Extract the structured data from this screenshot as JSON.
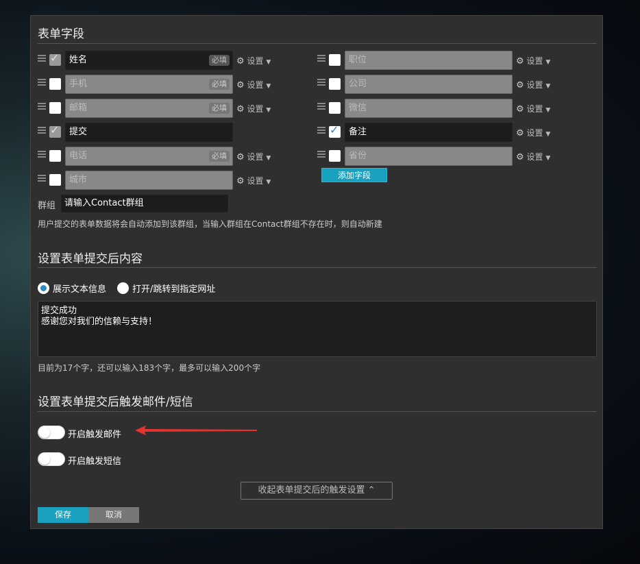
{
  "form_fields": {
    "title": "表单字段",
    "left": [
      {
        "label": "姓名",
        "checked": true,
        "locked": true,
        "required": "必填",
        "settings": "设置",
        "active": true
      },
      {
        "label": "手机",
        "checked": false,
        "locked": false,
        "required": "必填",
        "settings": "设置",
        "active": false
      },
      {
        "label": "邮箱",
        "checked": false,
        "locked": false,
        "required": "必填",
        "settings": "设置",
        "active": false
      },
      {
        "label": "提交",
        "checked": true,
        "locked": true,
        "required": "",
        "settings": "",
        "active": true
      },
      {
        "label": "电话",
        "checked": false,
        "locked": false,
        "required": "必填",
        "settings": "设置",
        "active": false
      },
      {
        "label": "城市",
        "checked": false,
        "locked": false,
        "required": "",
        "settings": "设置",
        "active": false
      }
    ],
    "right": [
      {
        "label": "职位",
        "checked": false,
        "settings": "设置",
        "active": false
      },
      {
        "label": "公司",
        "checked": false,
        "settings": "设置",
        "active": false
      },
      {
        "label": "微信",
        "checked": false,
        "settings": "设置",
        "active": false
      },
      {
        "label": "备注",
        "checked": true,
        "settings": "设置",
        "active": true
      },
      {
        "label": "省份",
        "checked": false,
        "settings": "设置",
        "active": false
      }
    ],
    "add_button": "添加字段",
    "group_label": "群组",
    "group_value": "请输入Contact群组",
    "group_hint": "用户提交的表单数据将会自动添加到该群组，当输入群组在Contact群组不存在时，则自动新建"
  },
  "after_submit": {
    "title": "设置表单提交后内容",
    "option_show_text": "展示文本信息",
    "option_redirect": "打开/跳转到指定网址",
    "selected": "show_text",
    "message_line1": "提交成功",
    "message_line2": "感谢您对我们的信赖与支持！",
    "char_hint": "目前为17个字，还可以输入183个字，最多可以输入200个字"
  },
  "triggers": {
    "title": "设置表单提交后触发邮件/短信",
    "email_label": "开启触发邮件",
    "sms_label": "开启触发短信",
    "email_enabled": false,
    "sms_enabled": false,
    "collapse_label": "收起表单提交后的触发设置 ⌃"
  },
  "actions": {
    "save": "保存",
    "cancel": "取消"
  },
  "colors": {
    "accent": "#1aa1bf",
    "arrow": "#e8322e"
  }
}
